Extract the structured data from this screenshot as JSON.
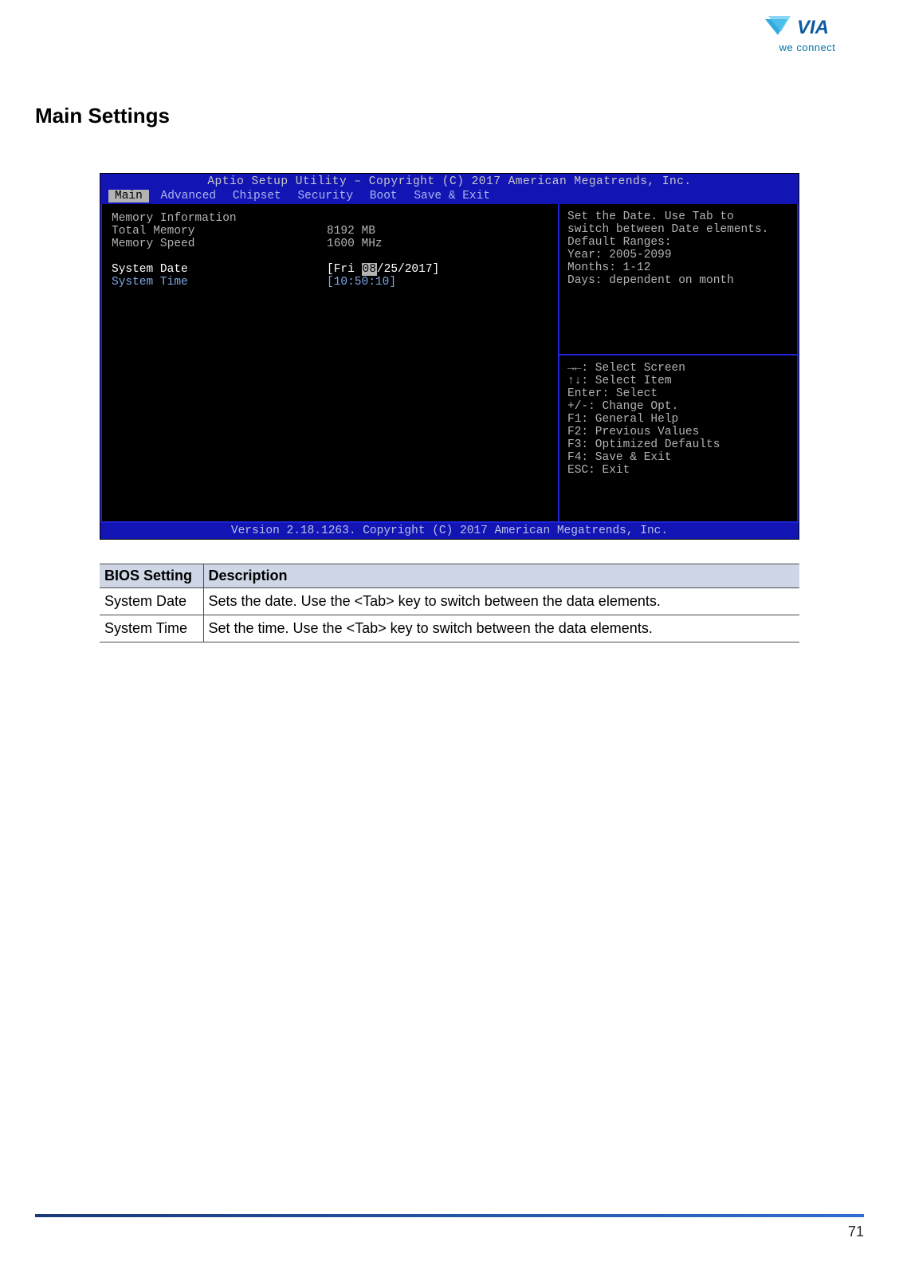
{
  "logo": {
    "tagline": "we connect"
  },
  "page": {
    "heading": "Main Settings",
    "number": "71"
  },
  "bios": {
    "title": "Aptio Setup Utility – Copyright (C) 2017 American Megatrends, Inc.",
    "tabs": [
      "Main",
      "Advanced",
      "Chipset",
      "Security",
      "Boot",
      "Save & Exit"
    ],
    "active_tab": "Main",
    "left": {
      "section_heading": "Memory Information",
      "rows": [
        {
          "label": "Total Memory",
          "value": "8192 MB"
        },
        {
          "label": "Memory Speed",
          "value": "1600 MHz"
        }
      ],
      "sysdate_label": "System Date",
      "sysdate_prefix": "[Fri ",
      "sysdate_hl": "08",
      "sysdate_suffix": "/25/2017]",
      "systime_label": "System Time",
      "systime_value": "[10:50:10]"
    },
    "right_top": [
      "Set the Date. Use Tab to",
      "switch between Date elements.",
      "Default Ranges:",
      "Year: 2005-2099",
      "Months: 1-12",
      "Days: dependent on month"
    ],
    "right_bottom": [
      "→←: Select Screen",
      "↑↓: Select Item",
      "Enter: Select",
      "+/-: Change Opt.",
      "F1: General Help",
      "F2: Previous Values",
      "F3: Optimized Defaults",
      "F4: Save & Exit",
      "ESC: Exit"
    ],
    "footer": "Version 2.18.1263. Copyright (C) 2017 American Megatrends, Inc."
  },
  "table": {
    "header": [
      "BIOS Setting",
      "Description"
    ],
    "rows": [
      {
        "setting": "System Date",
        "desc": "Sets the date. Use the <Tab> key to switch between the data elements."
      },
      {
        "setting": "System Time",
        "desc": "Set the time. Use the <Tab> key to switch between the data elements."
      }
    ]
  }
}
